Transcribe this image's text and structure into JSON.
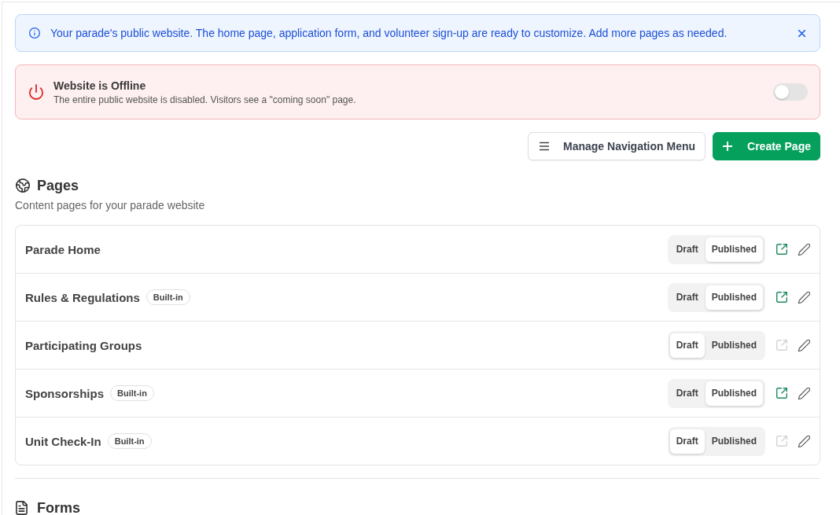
{
  "info_banner": {
    "text": "Your parade's public website. The home page, application form, and volunteer sign-up are ready to customize. Add more pages as needed."
  },
  "offline_banner": {
    "title": "Website is Offline",
    "description": "The entire public website is disabled. Visitors see a \"coming soon\" page.",
    "website_online": false
  },
  "toolbar": {
    "buttons": [
      {
        "label": "Manage Navigation Menu",
        "kind": "secondary"
      },
      {
        "label": "Create Page",
        "kind": "primary"
      }
    ]
  },
  "pages_section": {
    "title": "Pages",
    "subtitle": "Content pages for your parade website",
    "pages": [
      {
        "name": "Parade Home",
        "status": [
          {
            "label": "Draft",
            "selected": false
          },
          {
            "label": "Published",
            "selected": true
          }
        ],
        "view_enabled": true
      },
      {
        "name": "Rules & Regulations",
        "tag": "Built-in",
        "status": [
          {
            "label": "Draft",
            "selected": false
          },
          {
            "label": "Published",
            "selected": true
          }
        ],
        "view_enabled": true
      },
      {
        "name": "Participating Groups",
        "status": [
          {
            "label": "Draft",
            "selected": true
          },
          {
            "label": "Published",
            "selected": false
          }
        ],
        "view_enabled": false
      },
      {
        "name": "Sponsorships",
        "tag": "Built-in",
        "status": [
          {
            "label": "Draft",
            "selected": false
          },
          {
            "label": "Published",
            "selected": true
          }
        ],
        "view_enabled": true
      },
      {
        "name": "Unit Check-In",
        "tag": "Built-in",
        "status": [
          {
            "label": "Draft",
            "selected": true
          },
          {
            "label": "Published",
            "selected": false
          }
        ],
        "view_enabled": false
      }
    ]
  },
  "forms_section": {
    "title": "Forms"
  }
}
